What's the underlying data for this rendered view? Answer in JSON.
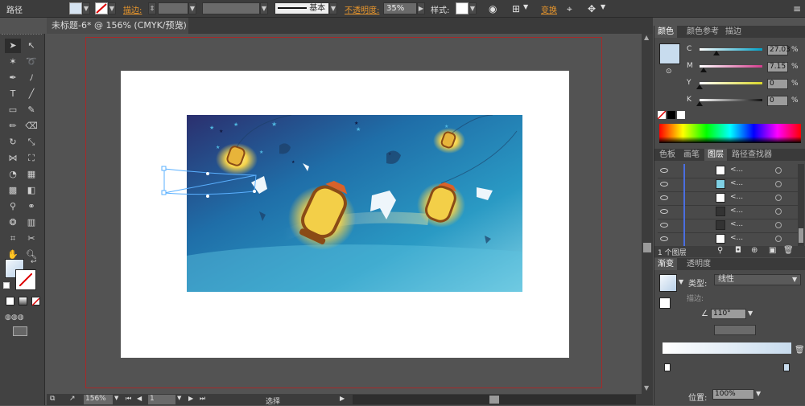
{
  "control_bar": {
    "object_type": "路径",
    "stroke_label": "描边:",
    "stroke_style": "基本",
    "opacity_label": "不透明度:",
    "opacity_value": "35%",
    "style_label": "样式:",
    "transform_label": "变换"
  },
  "document_tab": {
    "title": "未标题-6* @ 156% (CMYK/预览)",
    "close": "×"
  },
  "status_bar": {
    "zoom": "156%",
    "artboard": "1",
    "tool_status": "选择"
  },
  "color_panel": {
    "tabs": [
      "颜色",
      "颜色参考",
      "描边"
    ],
    "channels": [
      {
        "label": "C",
        "value": "27.03",
        "unit": "%",
        "fraction": 0.27,
        "color": "#00a0c6"
      },
      {
        "label": "M",
        "value": "7.15",
        "unit": "%",
        "fraction": 0.07,
        "color": "#d23c8c"
      },
      {
        "label": "Y",
        "value": "0",
        "unit": "%",
        "fraction": 0.0,
        "color": "#d9d62a"
      },
      {
        "label": "K",
        "value": "0",
        "unit": "%",
        "fraction": 0.0,
        "color": "#111111"
      }
    ],
    "fill_color": "#c8dcee"
  },
  "layers_panel": {
    "tabs": [
      "色板",
      "画笔",
      "图层",
      "路径查找器"
    ],
    "rows": [
      {
        "name": "<...",
        "thumb": "white"
      },
      {
        "name": "<...",
        "thumb": "teal"
      },
      {
        "name": "<...",
        "thumb": "white"
      },
      {
        "name": "<...",
        "thumb": "dark"
      },
      {
        "name": "<...",
        "thumb": "dark"
      },
      {
        "name": "<...",
        "thumb": "white"
      }
    ],
    "footer": "1 个图层"
  },
  "gradient_panel": {
    "tabs": [
      "渐变",
      "透明度"
    ],
    "type_label": "类型:",
    "type_value": "线性",
    "stroke_label": "描边:",
    "angle_value": "110°",
    "location_label": "位置:",
    "location_value": "100%"
  },
  "colors": {
    "accent_orange": "#e8962c",
    "artboard_border": "#a52a2a"
  }
}
